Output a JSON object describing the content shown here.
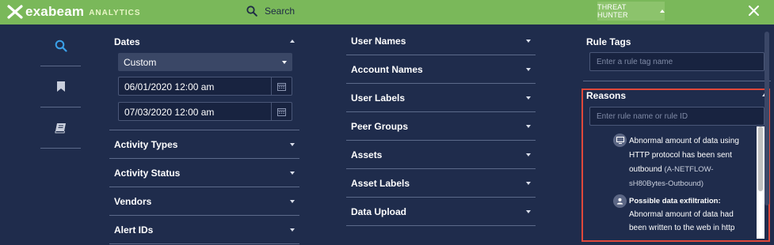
{
  "topbar": {
    "brand": "exabeam",
    "brand_sub": "ANALYTICS",
    "search_label": "Search",
    "threat_hunter_label": "THREAT HUNTER"
  },
  "rail": {
    "icons": [
      "search-icon",
      "bookmark-icon",
      "book-icon"
    ]
  },
  "dates": {
    "title": "Dates",
    "range_select": "Custom",
    "start": "06/01/2020 12:00 am",
    "end": "07/03/2020 12:00 am"
  },
  "left_sections": [
    "Activity Types",
    "Activity Status",
    "Vendors",
    "Alert IDs"
  ],
  "middle_sections": [
    "User Names",
    "Account Names",
    "User Labels",
    "Peer Groups",
    "Assets",
    "Asset Labels",
    "Data Upload"
  ],
  "rule_tags": {
    "title": "Rule Tags",
    "placeholder": "Enter a rule tag name"
  },
  "reasons": {
    "title": "Reasons",
    "placeholder": "Enter rule name or rule ID",
    "items": [
      {
        "icon": "computer-icon",
        "name_lines": [
          "Abnormal amount of data using",
          "HTTP protocol has been sent",
          "outbound"
        ],
        "rule_id_a": "(A-NETFLOW-",
        "rule_id_b": "sH80Bytes-Outbound)"
      },
      {
        "icon": "user-icon",
        "title": "Possible data exfiltration:",
        "body_lines": [
          "Abnormal amount of data had",
          "been written to the web in http"
        ]
      }
    ]
  },
  "colors": {
    "topbar": "#7ab85a",
    "background": "#1f2c4c",
    "accent_search": "#3aa0e8",
    "highlight": "#e0483a"
  }
}
